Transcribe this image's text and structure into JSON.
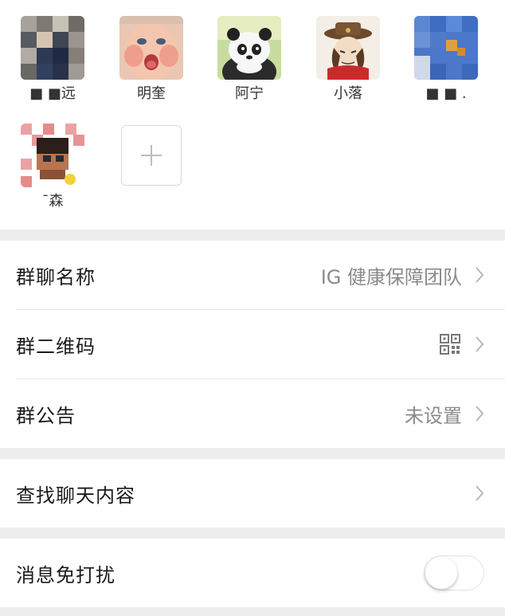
{
  "members": [
    {
      "name": "■ ■远",
      "avatar_icon": "pixelated-person-avatar"
    },
    {
      "name": "明奎",
      "avatar_icon": "baby-face-avatar"
    },
    {
      "name": "阿宁",
      "avatar_icon": "panda-avatar"
    },
    {
      "name": "小落",
      "avatar_icon": "cowboy-cartoon-avatar"
    },
    {
      "name": "■ ■ .",
      "avatar_icon": "pixelated-blue-avatar"
    },
    {
      "name": "ˉ森",
      "avatar_icon": "pixelated-cartoon-avatar"
    }
  ],
  "add_member_icon": "plus-icon",
  "settings": {
    "group_name": {
      "label": "群聊名称",
      "value": "IG 健康保障团队"
    },
    "group_qr": {
      "label": "群二维码",
      "icon": "qr-code-icon"
    },
    "group_notice": {
      "label": "群公告",
      "value": "未设置"
    },
    "search_chat": {
      "label": "查找聊天内容"
    },
    "mute": {
      "label": "消息免打扰",
      "enabled": false
    }
  },
  "colors": {
    "background": "#ededed",
    "value_text": "#8a8a8a",
    "divider": "#e6e6e6"
  }
}
